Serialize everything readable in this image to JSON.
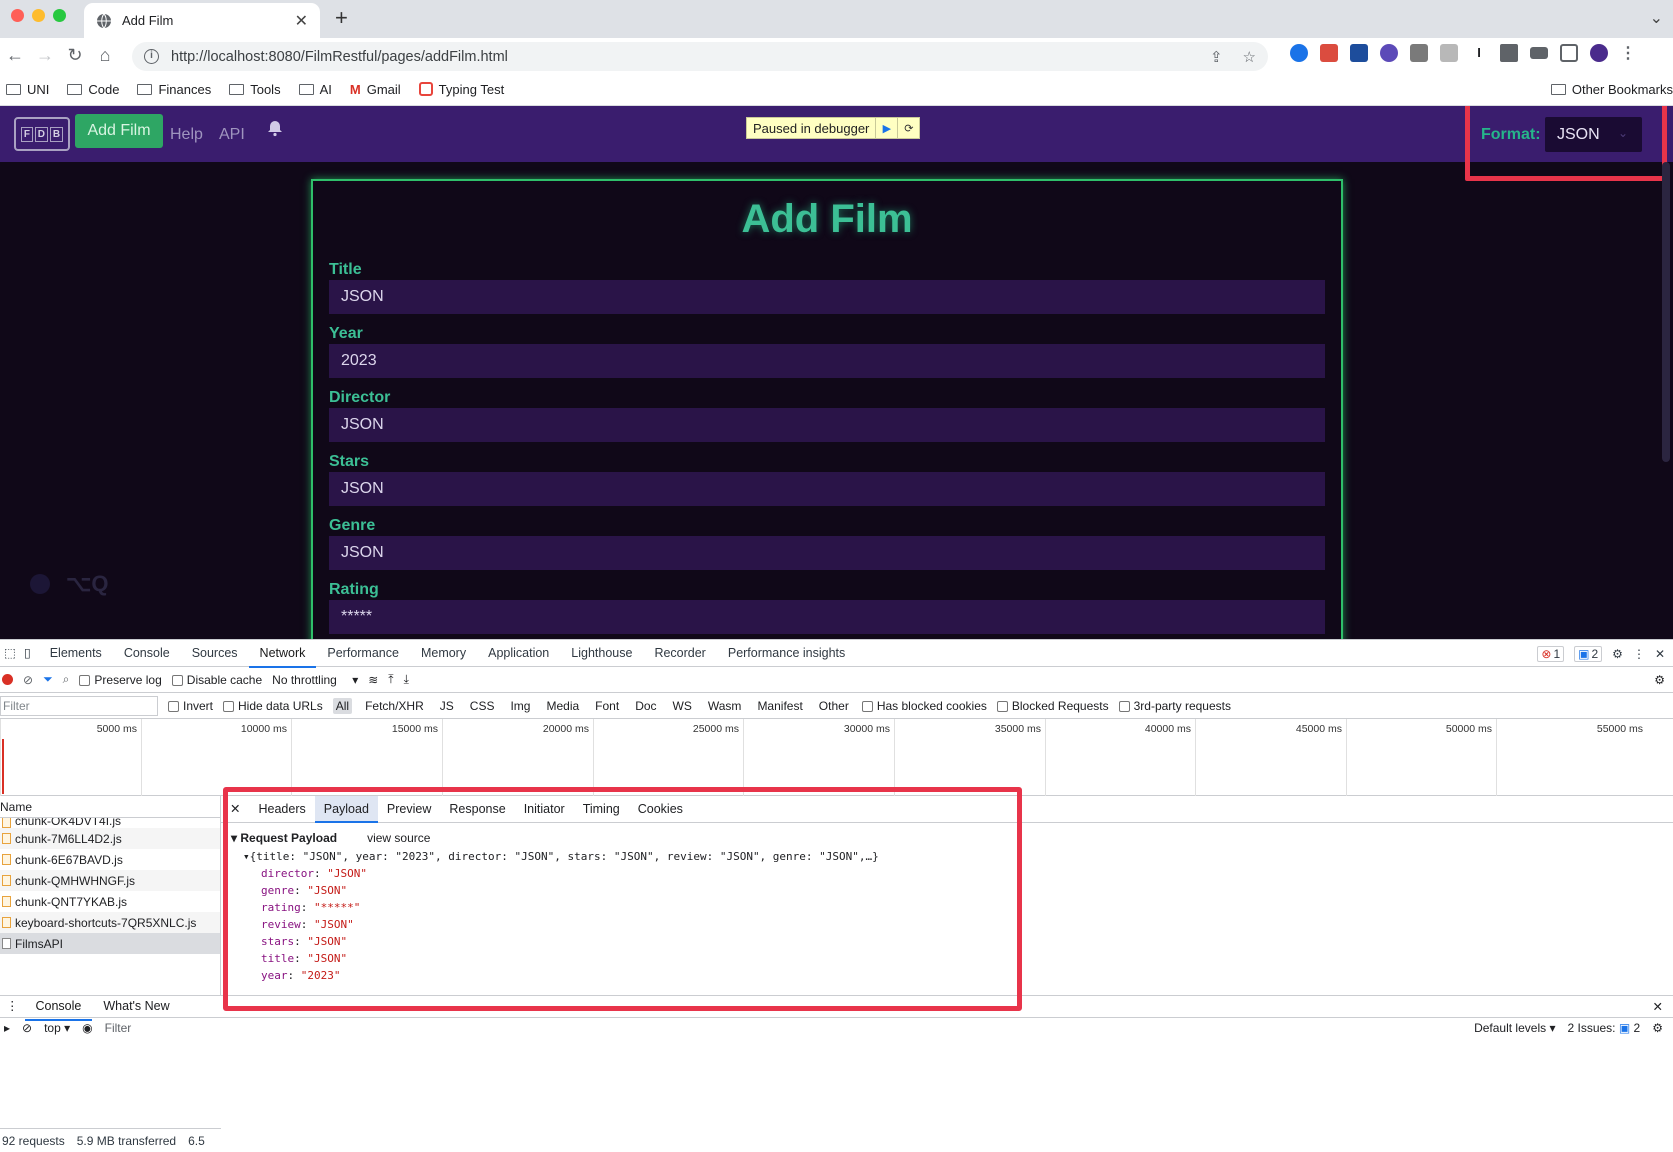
{
  "browser": {
    "tab_title": "Add Film",
    "new_tab": "+",
    "url": "http://localhost:8080/FilmRestful/pages/addFilm.html",
    "bookmarks": [
      "UNI",
      "Code",
      "Finances",
      "Tools",
      "AI",
      "Gmail",
      "Typing Test"
    ],
    "other_bookmarks": "Other Bookmarks"
  },
  "app": {
    "logo_letters": [
      "F",
      "D",
      "B"
    ],
    "nav": {
      "add_film": "Add Film",
      "help": "Help",
      "api": "API"
    },
    "debugger_text": "Paused in debugger",
    "format_label": "Format:",
    "format_value": "JSON",
    "form": {
      "title": "Add Film",
      "fields": [
        {
          "label": "Title",
          "value": "JSON"
        },
        {
          "label": "Year",
          "value": "2023"
        },
        {
          "label": "Director",
          "value": "JSON"
        },
        {
          "label": "Stars",
          "value": "JSON"
        },
        {
          "label": "Genre",
          "value": "JSON"
        },
        {
          "label": "Rating",
          "value": "*****"
        }
      ]
    },
    "qa_badge": "⌥Q"
  },
  "devtools": {
    "tabs": [
      "Elements",
      "Console",
      "Sources",
      "Network",
      "Performance",
      "Memory",
      "Application",
      "Lighthouse",
      "Recorder",
      "Performance insights"
    ],
    "active_tab": "Network",
    "error_count": "1",
    "message_count": "2",
    "network_toolbar": {
      "preserve_log": "Preserve log",
      "disable_cache": "Disable cache",
      "throttling": "No throttling"
    },
    "filter": {
      "placeholder": "Filter",
      "invert": "Invert",
      "hide_data_urls": "Hide data URLs",
      "types": [
        "All",
        "Fetch/XHR",
        "JS",
        "CSS",
        "Img",
        "Media",
        "Font",
        "Doc",
        "WS",
        "Wasm",
        "Manifest",
        "Other"
      ],
      "has_blocked_cookies": "Has blocked cookies",
      "blocked_requests": "Blocked Requests",
      "third_party": "3rd-party requests"
    },
    "timeline_ticks": [
      "5000 ms",
      "10000 ms",
      "15000 ms",
      "20000 ms",
      "25000 ms",
      "30000 ms",
      "35000 ms",
      "40000 ms",
      "45000 ms",
      "50000 ms",
      "55000 ms"
    ],
    "request_list": {
      "header": "Name",
      "rows": [
        "chunk-OK4DVT4I.js",
        "chunk-7M6LL4D2.js",
        "chunk-6E67BAVD.js",
        "chunk-QMHWHNGF.js",
        "chunk-QNT7YKAB.js",
        "keyboard-shortcuts-7QR5XNLC.js",
        "FilmsAPI"
      ],
      "requests": "92 requests",
      "transferred": "5.9 MB transferred",
      "resources": "6.5"
    },
    "detail_tabs": [
      "Headers",
      "Payload",
      "Preview",
      "Response",
      "Initiator",
      "Timing",
      "Cookies"
    ],
    "payload": {
      "section": "Request Payload",
      "view_source": "view source",
      "summary": "{title: \"JSON\", year: \"2023\", director: \"JSON\", stars: \"JSON\", review: \"JSON\", genre: \"JSON\",…}",
      "entries": [
        {
          "k": "director",
          "v": "\"JSON\""
        },
        {
          "k": "genre",
          "v": "\"JSON\""
        },
        {
          "k": "rating",
          "v": "\"*****\""
        },
        {
          "k": "review",
          "v": "\"JSON\""
        },
        {
          "k": "stars",
          "v": "\"JSON\""
        },
        {
          "k": "title",
          "v": "\"JSON\""
        },
        {
          "k": "year",
          "v": "\"2023\""
        }
      ]
    },
    "drawer": {
      "tabs": [
        "Console",
        "What's New"
      ],
      "context": "top",
      "filter": "Filter",
      "levels": "Default levels",
      "issues": "2 Issues:",
      "issues_count": "2"
    }
  }
}
